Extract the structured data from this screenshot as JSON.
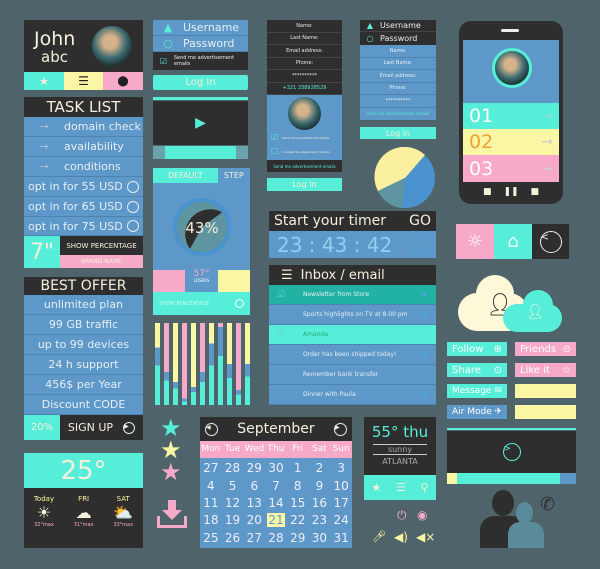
{
  "profile": {
    "first": "John",
    "last": "abc"
  },
  "tasks": {
    "title": "TASK LIST",
    "items": [
      "domain check",
      "availability",
      "conditions"
    ],
    "options": [
      "opt in for 55 USD",
      "opt in for 65 USD",
      "opt in for 75 USD"
    ],
    "size": "7\"",
    "show": "SHOW PERCENTAGE",
    "brand": "BRAND NAME"
  },
  "offer": {
    "title": "BEST OFFER",
    "items": [
      "unlimited plan",
      "99 GB traffic",
      "up to 99 devices",
      "24 h support",
      "456$ per Year",
      "Discount CODE"
    ],
    "discount": "20%",
    "signup": "SIGN UP"
  },
  "weather": {
    "temp": "25°",
    "days": [
      {
        "d": "Today",
        "t": "32°max"
      },
      {
        "d": "FRI",
        "t": "31°max"
      },
      {
        "d": "SAT",
        "t": "33°max"
      }
    ]
  },
  "login1": {
    "username": "Username",
    "password": "Password",
    "ads": "Send me advertisement emails",
    "login": "Log In"
  },
  "gauge": {
    "tab_default": "DEFAULT",
    "tab_step": "STEP",
    "percent": "43%",
    "percent_value": 43,
    "stat": "57°",
    "stat_label": "LOSERS",
    "show": "SHOW PERCENTAGE"
  },
  "form": {
    "fields": [
      "Name:",
      "Last Name:",
      "Email address:",
      "Phone:",
      "**********",
      "+321 338928529"
    ],
    "ads": "Send me advertisement emails",
    "agree": "I Accept the Agreement (terms)",
    "footer": "Send me advertisement emails",
    "login": "Log In"
  },
  "login2": {
    "username": "Username",
    "password": "Password",
    "fields": [
      "Name:",
      "Last Name:",
      "Email address:",
      "Phone:",
      "**********"
    ],
    "ads": "Send me advertisement emails",
    "login": "Log In"
  },
  "timer": {
    "title": "Start your timer",
    "go": "GO",
    "time": "23 : 43 : 42"
  },
  "inbox": {
    "title": "Inbox / email",
    "items": [
      "Newsletter from Store",
      "Sports highlights on TV at 8.00 pm",
      "Amanda",
      "Order has been shipped today!",
      "Remember bank transfer",
      "Dinner with Paula"
    ]
  },
  "calendar": {
    "month": "September",
    "days": [
      "Mon",
      "Tue",
      "Wed",
      "Thu",
      "Fri",
      "Sat",
      "Sun"
    ],
    "dates": [
      "27",
      "28",
      "29",
      "30",
      "1",
      "2",
      "3",
      "4",
      "5",
      "6",
      "7",
      "8",
      "9",
      "10",
      "11",
      "12",
      "13",
      "14",
      "15",
      "16",
      "17",
      "18",
      "19",
      "20",
      "21",
      "22",
      "23",
      "24",
      "25",
      "26",
      "27",
      "28",
      "29",
      "30",
      "31"
    ],
    "selected": "21"
  },
  "weather2": {
    "temp": "55° thu",
    "cond": "sunny",
    "city": "ATLANTA"
  },
  "phone": {
    "items": [
      "01",
      "02",
      "03"
    ]
  },
  "social": {
    "follow": "Follow",
    "friends": "Friends",
    "share": "Share",
    "like": "Like it",
    "message": "Message",
    "air": "Air Mode"
  },
  "colors": {
    "dark": "#2e2e2e",
    "blue": "#5e98c8",
    "turquoise": "#56eed8",
    "pink": "#f7a9c9",
    "yellow": "#fbf6a4"
  }
}
